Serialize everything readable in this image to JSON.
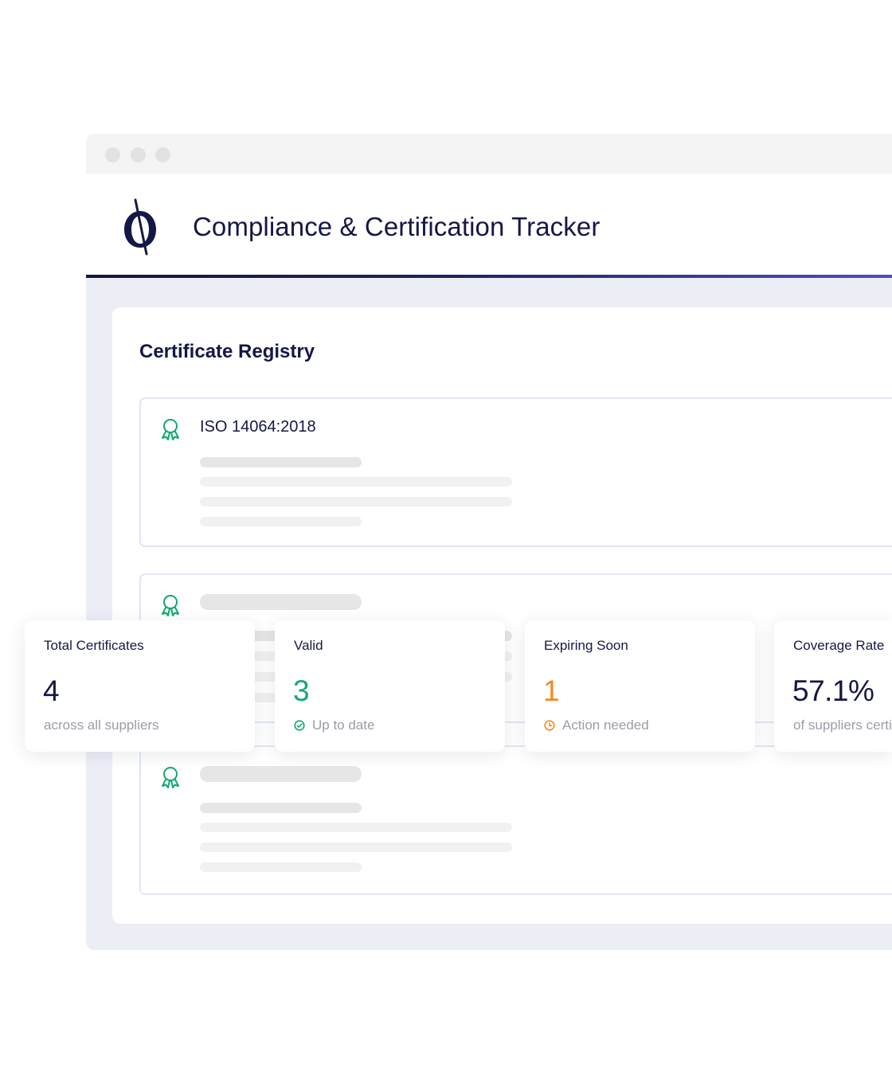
{
  "app": {
    "title": "Compliance & Certification Tracker"
  },
  "registry": {
    "title": "Certificate Registry",
    "certificates": [
      {
        "name": "ISO 14064:2018",
        "icon": "award-ribbon-icon"
      },
      {
        "name": "",
        "icon": "award-ribbon-icon"
      },
      {
        "name": "",
        "icon": "award-ribbon-icon"
      }
    ]
  },
  "stats": [
    {
      "label": "Total Certificates",
      "value": "4",
      "sub": "across all suppliers",
      "color": "#151746"
    },
    {
      "label": "Valid",
      "value": "3",
      "sub": "Up to date",
      "color": "#14a86e",
      "icon": "check-circle-icon"
    },
    {
      "label": "Expiring Soon",
      "value": "1",
      "sub": "Action needed",
      "color": "#f28a1e",
      "icon": "clock-icon"
    },
    {
      "label": "Coverage Rate",
      "value": "57.1%",
      "sub": "of suppliers certified",
      "color": "#151746"
    }
  ],
  "colors": {
    "accent_green": "#14a86e",
    "accent_orange": "#f28a1e",
    "navy": "#151746",
    "header_rule_end": "#5050c6"
  }
}
